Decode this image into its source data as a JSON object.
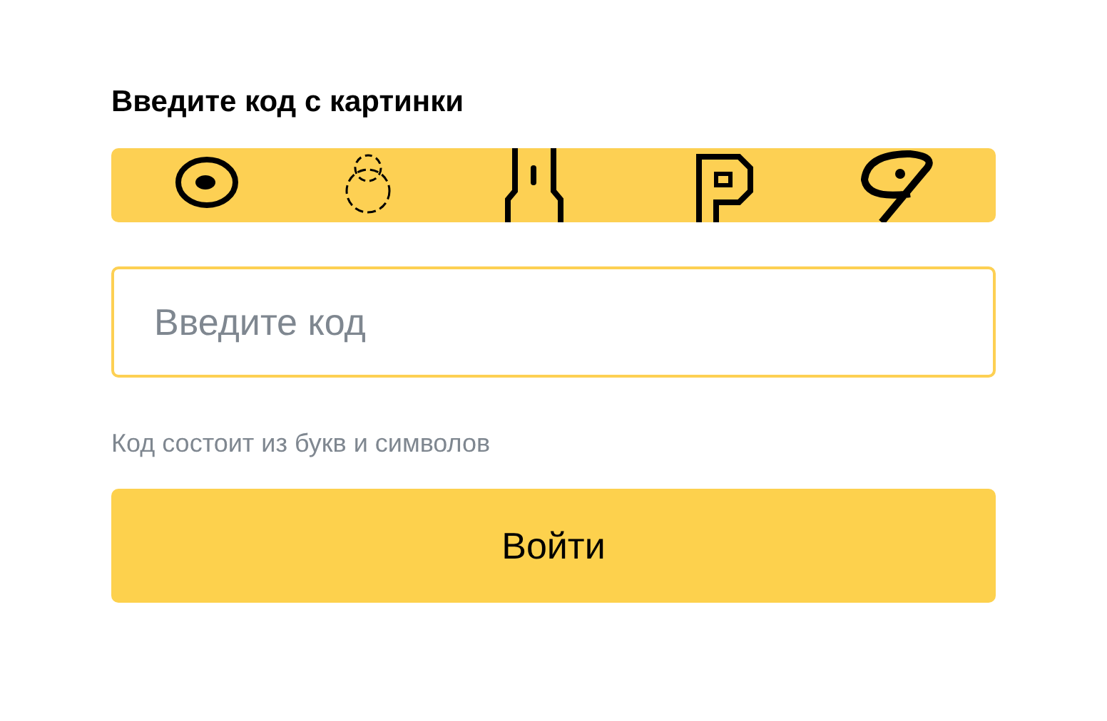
{
  "title": "Введите код с картинки",
  "code_field": {
    "placeholder": "Введите код"
  },
  "hint": "Код состоит из букв и символов",
  "submit_button": "Войти"
}
